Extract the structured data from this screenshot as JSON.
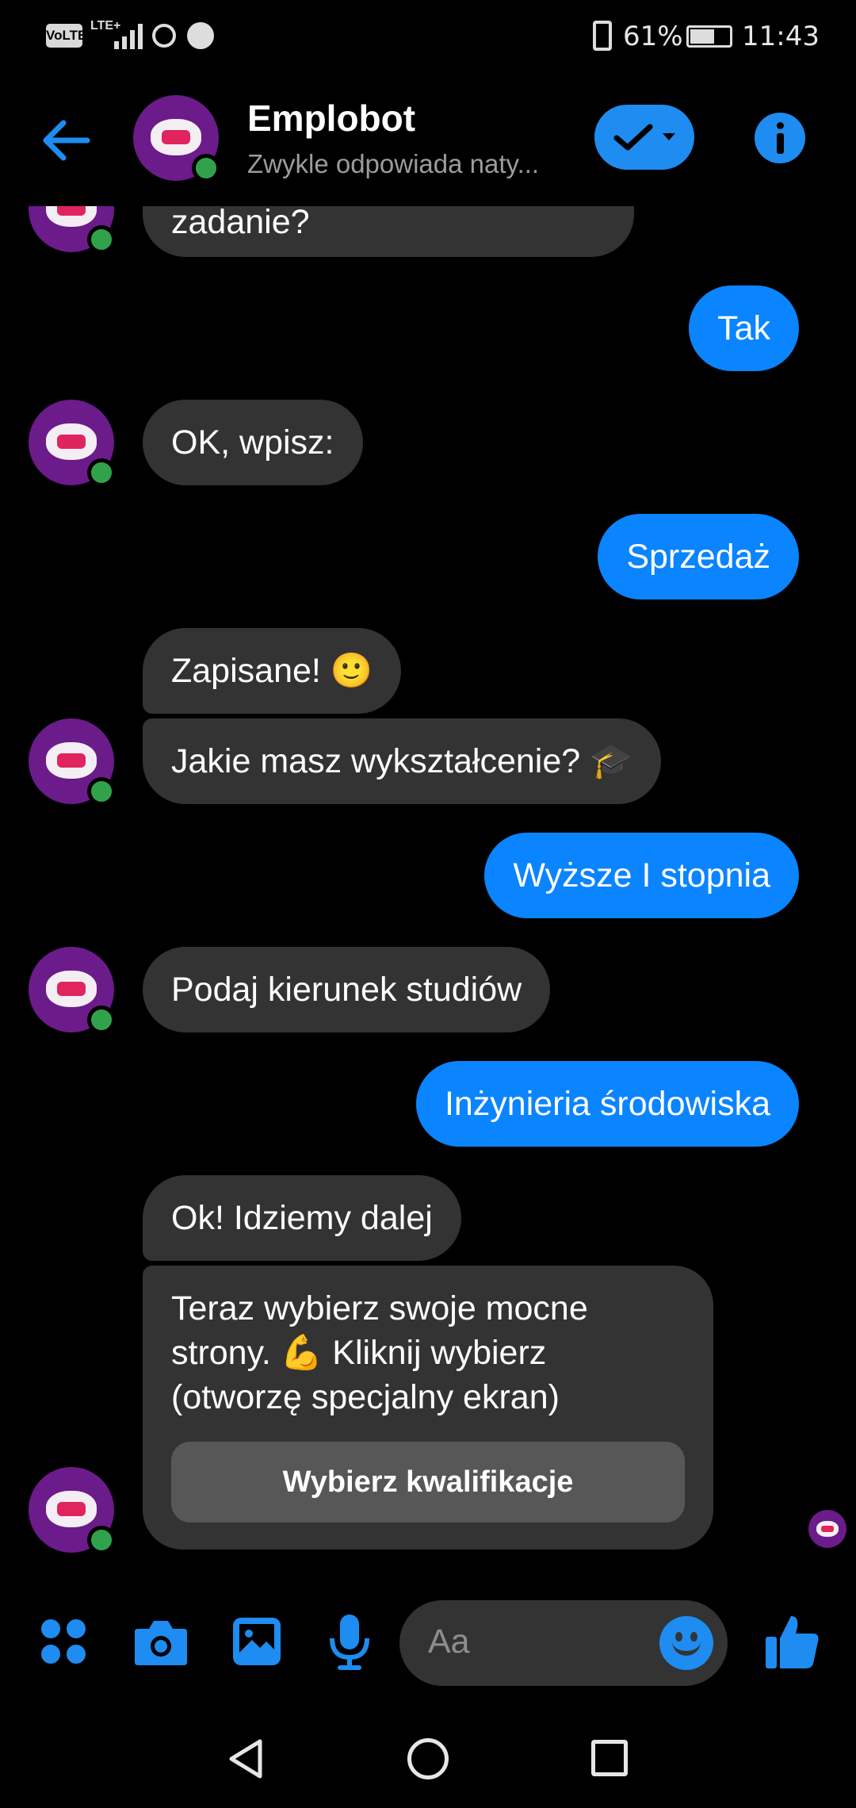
{
  "status_bar": {
    "battery": "61%",
    "time": "11:43",
    "network_badge": "VoLTE",
    "signal_badge": "LTE+"
  },
  "header": {
    "name": "Emplobot",
    "subtitle": "Zwykle odpowiada naty..."
  },
  "messages": [
    {
      "id": "m0",
      "from": "bot",
      "text": "zadanie?"
    },
    {
      "id": "m1",
      "from": "user",
      "text": "Tak"
    },
    {
      "id": "m2",
      "from": "bot",
      "text": "OK, wpisz:"
    },
    {
      "id": "m3",
      "from": "user",
      "text": "Sprzedaż"
    },
    {
      "id": "m4",
      "from": "bot",
      "text": "Zapisane! 🙂"
    },
    {
      "id": "m5",
      "from": "bot",
      "text": "Jakie masz wykształcenie? 🎓"
    },
    {
      "id": "m6",
      "from": "user",
      "text": "Wyższe I stopnia"
    },
    {
      "id": "m7",
      "from": "bot",
      "text": "Podaj kierunek studiów"
    },
    {
      "id": "m8",
      "from": "user",
      "text": "Inżynieria środowiska"
    },
    {
      "id": "m9",
      "from": "bot",
      "text": "Ok! Idziemy dalej"
    },
    {
      "id": "m10",
      "from": "bot",
      "lines": [
        "Teraz wybierz swoje mocne",
        "strony. 💪  Kliknij wybierz",
        "(otworzę specjalny ekran)"
      ],
      "button": "Wybierz kwalifikacje"
    }
  ],
  "composer": {
    "placeholder": "Aa"
  },
  "icons": {
    "back": "arrow-left-icon",
    "menu": "four-dots-icon",
    "camera": "camera-icon",
    "gallery": "image-icon",
    "mic": "microphone-icon",
    "emoji": "smiley-icon",
    "like": "thumbs-up-icon",
    "info": "info-icon"
  },
  "colors": {
    "accent": "#0a84ff",
    "incoming_bubble": "#333333",
    "avatar_bg": "#6b1b8a",
    "online": "#31a24c",
    "icon": "#1e8cf0"
  }
}
